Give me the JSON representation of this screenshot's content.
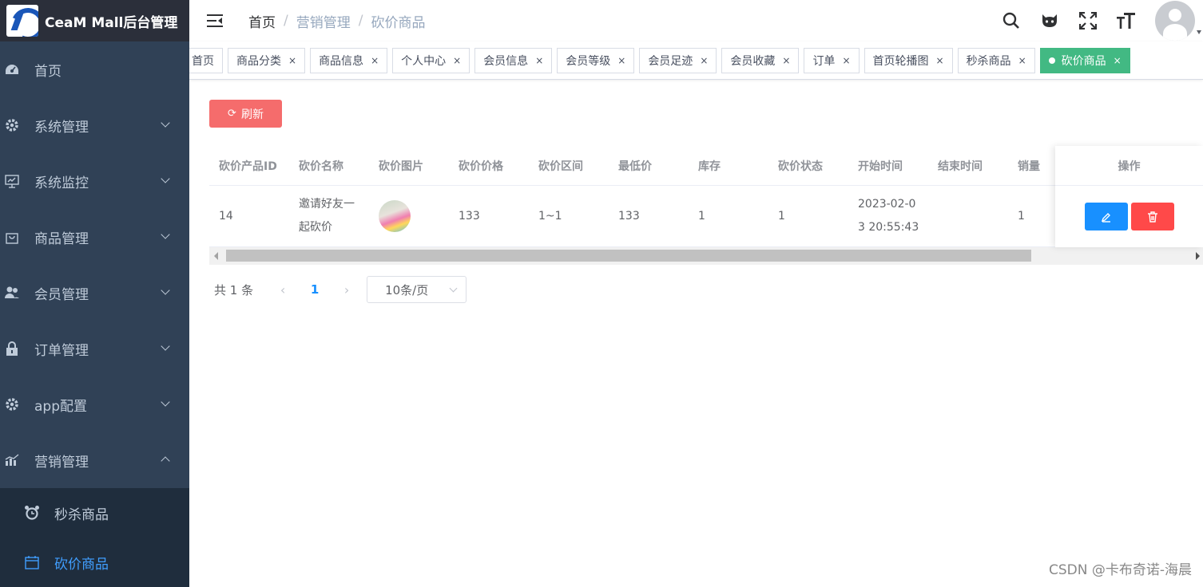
{
  "app": {
    "title": "CeaM Mall后台管理"
  },
  "sidebar": {
    "items": [
      {
        "label": "首页",
        "icon": "dashboard-icon",
        "has_arrow": false
      },
      {
        "label": "系统管理",
        "icon": "gear-icon",
        "has_arrow": true
      },
      {
        "label": "系统监控",
        "icon": "monitor-icon",
        "has_arrow": true
      },
      {
        "label": "商品管理",
        "icon": "shopping-bag-icon",
        "has_arrow": true
      },
      {
        "label": "会员管理",
        "icon": "users-icon",
        "has_arrow": true
      },
      {
        "label": "订单管理",
        "icon": "lock-icon",
        "has_arrow": true
      },
      {
        "label": "app配置",
        "icon": "gear-icon",
        "has_arrow": true
      },
      {
        "label": "营销管理",
        "icon": "chart-icon",
        "has_arrow": true,
        "expanded": true
      }
    ],
    "submenu": [
      {
        "label": "秒杀商品",
        "icon": "alarm-clock-icon",
        "active": false
      },
      {
        "label": "砍价商品",
        "icon": "calendar-icon",
        "active": true
      }
    ]
  },
  "breadcrumb": [
    "首页",
    "营销管理",
    "砍价商品"
  ],
  "header_icons": [
    "search-icon",
    "github-icon",
    "fullscreen-icon",
    "font-size-icon"
  ],
  "tags": [
    {
      "label": "首页",
      "closable": false,
      "active": false
    },
    {
      "label": "商品分类",
      "closable": true,
      "active": false
    },
    {
      "label": "商品信息",
      "closable": true,
      "active": false
    },
    {
      "label": "个人中心",
      "closable": true,
      "active": false
    },
    {
      "label": "会员信息",
      "closable": true,
      "active": false
    },
    {
      "label": "会员等级",
      "closable": true,
      "active": false
    },
    {
      "label": "会员足迹",
      "closable": true,
      "active": false
    },
    {
      "label": "会员收藏",
      "closable": true,
      "active": false
    },
    {
      "label": "订单",
      "closable": true,
      "active": false
    },
    {
      "label": "首页轮播图",
      "closable": true,
      "active": false
    },
    {
      "label": "秒杀商品",
      "closable": true,
      "active": false
    },
    {
      "label": "砍价商品",
      "closable": true,
      "active": true
    }
  ],
  "toolbar": {
    "refresh_label": "刷新"
  },
  "table": {
    "columns": [
      "砍价产品ID",
      "砍价名称",
      "砍价图片",
      "砍价价格",
      "砍价区间",
      "最低价",
      "库存",
      "砍价状态",
      "开始时间",
      "结束时间",
      "销量"
    ],
    "operation_header": "操作",
    "rows": [
      {
        "id": "14",
        "name": "邀请好友一起砍价",
        "name_lines": [
          "邀请好友一",
          "起砍价"
        ],
        "price": "133",
        "range": "1~1",
        "min_price": "133",
        "stock": "1",
        "status": "1",
        "start_time_lines": [
          "2023-02-0",
          "3 20:55:43"
        ],
        "end_time": "",
        "sales": "1"
      }
    ]
  },
  "pagination": {
    "total": "共 1 条",
    "current": "1",
    "page_size": "10条/页"
  },
  "watermark": "CSDN @卡布奇诺-海晨",
  "colors": {
    "sidebar": "#304156",
    "active_tag": "#42b983",
    "primary": "#1890ff",
    "danger": "#f56c6c"
  }
}
